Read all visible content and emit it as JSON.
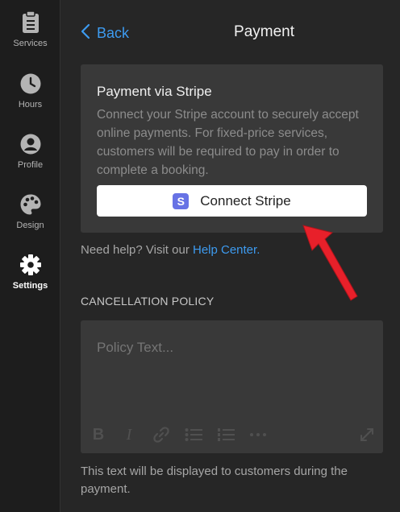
{
  "sidebar": {
    "items": [
      {
        "label": "Services",
        "icon": "clipboard-icon",
        "active": false
      },
      {
        "label": "Hours",
        "icon": "clock-icon",
        "active": false
      },
      {
        "label": "Profile",
        "icon": "person-icon",
        "active": false
      },
      {
        "label": "Design",
        "icon": "palette-icon",
        "active": false
      },
      {
        "label": "Settings",
        "icon": "gear-icon",
        "active": true
      }
    ]
  },
  "header": {
    "back_label": "Back",
    "title": "Payment"
  },
  "stripe": {
    "title": "Payment via Stripe",
    "description": "Connect your Stripe account to securely accept online payments. For fixed-price services, customers will be required to pay in order to complete a booking.",
    "logo_letter": "S",
    "button_label": "Connect Stripe"
  },
  "help": {
    "prefix": "Need help? Visit our ",
    "link": "Help Center."
  },
  "cancellation": {
    "heading": "CANCELLATION POLICY",
    "placeholder": "Policy Text...",
    "toolbar": [
      "bold-icon",
      "italic-icon",
      "link-icon",
      "bulleted-list-icon",
      "numbered-list-icon",
      "more-icon",
      "expand-icon"
    ],
    "toolbar_labels": {
      "bold": "B",
      "italic": "I"
    },
    "note": "This text will be displayed to customers during the payment."
  },
  "colors": {
    "accent": "#3d9bf0",
    "stripe": "#6772e5",
    "annotation": "#e8202a"
  }
}
